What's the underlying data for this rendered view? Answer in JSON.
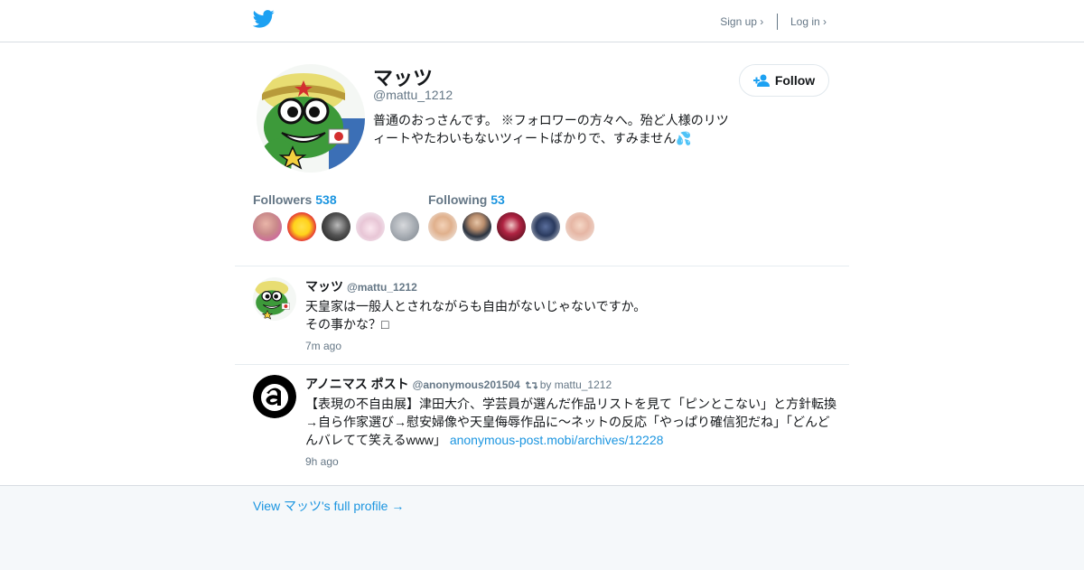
{
  "header": {
    "signup_label": "Sign up ›",
    "login_label": "Log in ›",
    "logo_icon": "twitter-bird-icon",
    "accent_color": "#1da1f2"
  },
  "profile": {
    "display_name": "マッツ",
    "handle": "@mattu_1212",
    "bio": "普通のおっさんです。 ※フォロワーの方々へ。殆ど人様のリツィートやたわいもないツィートばかりで、すみません💦",
    "follow_label": "Follow",
    "followers_label": "Followers",
    "followers_count": "538",
    "following_label": "Following",
    "following_count": "53"
  },
  "tweets": [
    {
      "author": "マッツ",
      "handle": "@mattu_1212",
      "retweet_label": "",
      "text_lines": [
        "天皇家は一般人とされながらも自由がないじゃないですか。",
        "その事かな？□"
      ],
      "link": "",
      "time": "7m ago"
    },
    {
      "author": "アノニマス ポスト",
      "handle": "@anonymous201504",
      "retweet_label": "by mattu_1212",
      "text_lines": [
        "【表現の不自由展】津田大介、学芸員が選んだ作品リストを見て「ピンとこない」と方針転換→自ら作家選び→慰安婦像や天皇侮辱作品に～ネットの反応「やっぱり確信犯だね」「どんどんバレてて笑えるwww」"
      ],
      "link": "anonymous-post.mobi/archives/12228",
      "time": "9h ago"
    }
  ],
  "footer": {
    "full_profile_label": "View マッツ's full profile →"
  }
}
